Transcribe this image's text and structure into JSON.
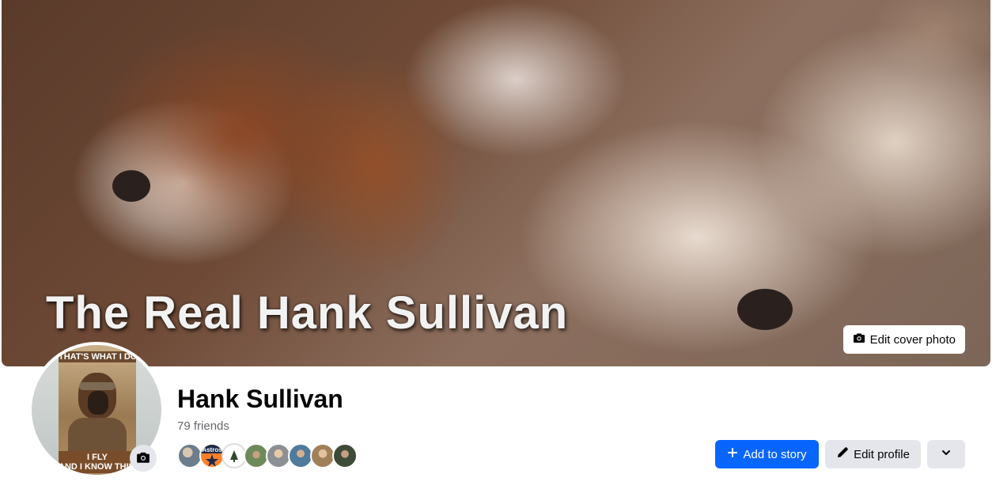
{
  "cover": {
    "title_text": "The Real Hank Sullivan",
    "edit_cover_label": "Edit cover photo"
  },
  "profile": {
    "avatar_poster_top": "THAT'S WHAT I DO",
    "avatar_poster_bottom_1": "I FLY",
    "avatar_poster_bottom_2": "AND I KNOW THINGS",
    "name": "Hank Sullivan",
    "friends_count": "79 friends",
    "friend_avatar_badge": "Astros"
  },
  "actions": {
    "add_to_story_label": "Add to story",
    "edit_profile_label": "Edit profile"
  },
  "icons": {
    "camera": "camera-icon",
    "plus": "plus-icon",
    "pencil": "pencil-icon",
    "chevron": "chevron-down-icon"
  },
  "colors": {
    "primary": "#0866ff",
    "secondary_bg": "#e4e6eb",
    "text": "#050505",
    "muted": "#65676b"
  }
}
